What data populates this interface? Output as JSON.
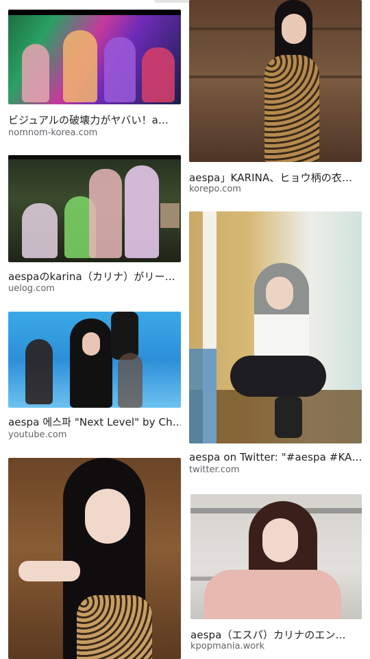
{
  "results": [
    {
      "title": "ビジュアルの破壊力がヤバい！a…",
      "source": "nomnom-korea.com",
      "image_alt": "group-neon-photo"
    },
    {
      "title": "aespa」KARINA、ヒョウ柄の衣…",
      "source": "korepo.com",
      "image_alt": "leopard-dress-photo"
    },
    {
      "title": "aespaのkarina（カリナ）がリー…",
      "source": "uelog.com",
      "image_alt": "group-studio-photo"
    },
    {
      "title": "aespa 에스파 \"Next Level\" by Ch…",
      "source": "youtube.com",
      "image_alt": "blue-stage-photo"
    },
    {
      "title": "aespa on Twitter: \"#aespa #KA…",
      "source": "twitter.com",
      "image_alt": "sitting-on-floor-photo"
    },
    {
      "title": "aespa（エスパ）カリナのエン…",
      "source": "kpopmania.work",
      "image_alt": "pink-cardigan-photo"
    },
    {
      "title": "",
      "source": "",
      "image_alt": "leopard-top-portrait-photo"
    }
  ]
}
